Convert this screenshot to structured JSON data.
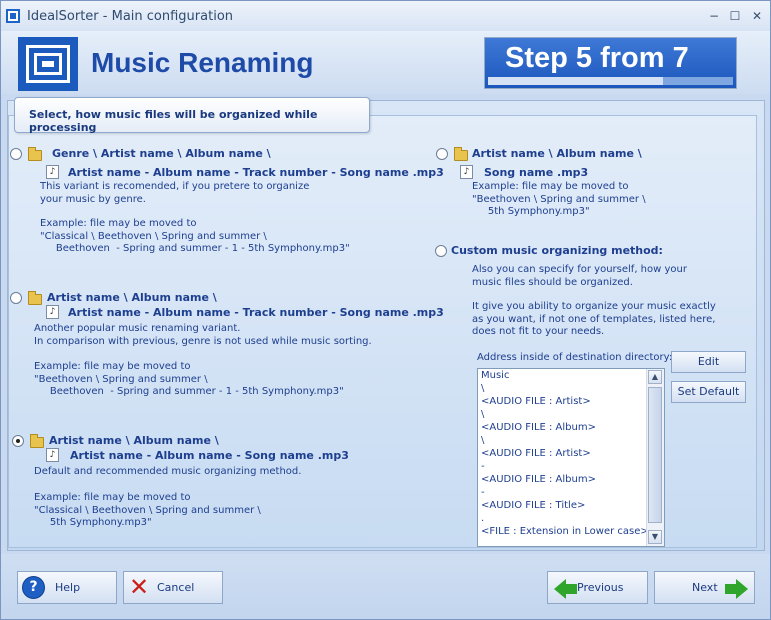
{
  "window": {
    "title": "IdealSorter - Main configuration",
    "minimize": "−",
    "maximize": "☐",
    "close": "✕"
  },
  "header": {
    "title": "Music Renaming",
    "step_text": "Step 5 from 7",
    "step_progress": "5/7"
  },
  "section": {
    "title": "Select, how music files will be organized while processing"
  },
  "options": [
    {
      "line1": "Genre \\ Artist name \\ Album name \\",
      "line2": "Artist name - Album name - Track number - Song name .mp3",
      "desc": "This variant is recomended, if you pretere to organize\nyour music by genre.",
      "example": "Example: file may be moved to\n\"Classical \\ Beethoven \\ Spring and summer \\\n     Beethoven  - Spring and summer - 1 - 5th Symphony.mp3\"",
      "selected": false
    },
    {
      "line1": "Artist name \\ Album name \\",
      "line2": "Artist name - Album name - Track number - Song name .mp3",
      "desc": "Another popular music renaming variant.\nIn comparison with previous, genre is not used while music sorting.",
      "example": "Example: file may be moved to\n\"Beethoven \\ Spring and summer \\\n     Beethoven  - Spring and summer - 1 - 5th Symphony.mp3\"",
      "selected": false
    },
    {
      "line1": "Artist name \\ Album name \\",
      "line2": "Artist name - Album name - Song name .mp3",
      "desc": "Default and recommended music organizing method.",
      "example": "Example: file may be moved to\n\"Classical \\ Beethoven \\ Spring and summer \\\n     5th Symphony.mp3\"",
      "selected": true
    },
    {
      "line1": "Artist name \\ Album name \\",
      "line2": "Song name .mp3",
      "example": "Example: file may be moved to\n\"Beethoven \\ Spring and summer \\\n     5th Symphony.mp3\"",
      "selected": false
    }
  ],
  "custom": {
    "label": "Custom music organizing method:",
    "desc1": "Also you can specify for yourself, how your\nmusic files should be organized.",
    "desc2": "It give you ability to organize your music exactly\nas you want, if not one of templates, listed here,\ndoes not fit to your needs.",
    "address_label": "Address inside of destination directory:",
    "address_lines": [
      "Music",
      "\\",
      "<AUDIO FILE : Artist>",
      "\\",
      "<AUDIO FILE : Album>",
      "\\",
      "<AUDIO FILE : Artist>",
      " -",
      "<AUDIO FILE : Album>",
      " -",
      "<AUDIO FILE : Title>",
      ".",
      "<FILE : Extension in Lower case>"
    ],
    "edit_button": "Edit",
    "default_button": "Set Default",
    "scroll_up": "▲",
    "scroll_down": "▼"
  },
  "footer": {
    "help": "Help",
    "cancel": "Cancel",
    "previous": "Previous",
    "next": "Next"
  },
  "icons": {
    "help": "?",
    "cancel": "✕",
    "note": "♪"
  }
}
